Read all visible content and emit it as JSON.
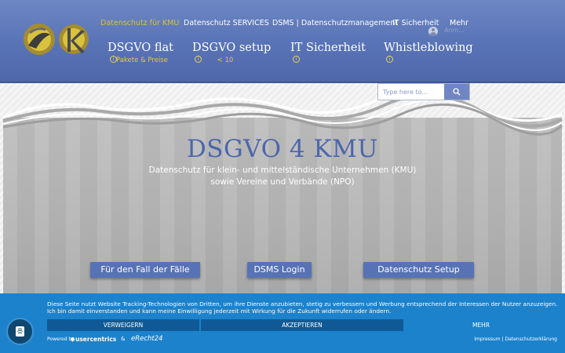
{
  "header": {
    "top_nav": [
      {
        "label": "Datenschutz für KMU",
        "active": true
      },
      {
        "label": "Datenschutz SERVICES",
        "active": false
      },
      {
        "label": "DSMS | Datenschutzmanagement",
        "active": false
      },
      {
        "label": "IT Sicherheit",
        "active": false
      },
      {
        "label": "Mehr",
        "active": false
      }
    ],
    "login_label": "Anm...",
    "main_nav": [
      {
        "title": "DSGVO flat",
        "sub": "Pakete & Preise"
      },
      {
        "title": "DSGVO setup",
        "sub": "< 10"
      },
      {
        "title": "IT Sicherheit",
        "sub": ""
      },
      {
        "title": "Whistleblowing",
        "sub": ""
      }
    ],
    "info_glyph": "i"
  },
  "search": {
    "placeholder": "Type here to..."
  },
  "hero": {
    "title": "DSGVO 4 KMU",
    "tagline_1": "Datenschutz für klein- und mittelständische Unternehmen (KMU)",
    "tagline_2": "sowie Vereine und Verbände (NPO)",
    "buttons": [
      "Für den Fall der Fälle",
      "DSMS Login",
      "Datenschutz Setup"
    ]
  },
  "cookie_banner": {
    "text": "Diese Seite nutzt Website Tracking-Technologien von Dritten, um ihre Dienste anzubieten, stetig zu verbessern und Werbung entsprechend der Interessen der Nutzer anzuzeigen. Ich bin damit einverstanden und kann meine Einwilligung jederzeit mit Wirkung für die Zukunft widerrufen oder ändern.",
    "deny": "VERWEIGERN",
    "accept": "AKZEPTIEREN",
    "more": "MEHR",
    "powered_by": "Powered by",
    "usercentrics": "usercentrics",
    "amp": "&",
    "erecht": "eRecht24",
    "imprint": "Impressum",
    "separator": "|",
    "privacy": "Datenschutzerklärung"
  },
  "colors": {
    "header_blue": "#5873b6",
    "accent_gold": "#d8c23e",
    "hero_title": "#4c66ad",
    "cookie_blue": "#1c82cc",
    "cookie_button": "#0f5a96"
  },
  "icons": {
    "search": "search-icon",
    "info": "info-icon",
    "user": "user-avatar-icon",
    "fingerprint": "fingerprint-icon"
  }
}
